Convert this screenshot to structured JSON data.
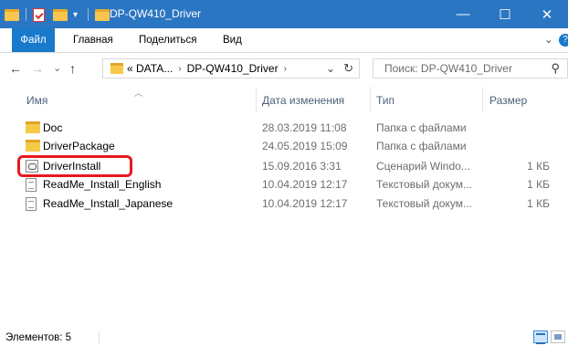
{
  "window": {
    "title": "DP-QW410_Driver",
    "minimize_glyph": "—",
    "maximize_glyph": "☐",
    "close_glyph": "✕"
  },
  "ribbon": {
    "tabs": [
      "Файл",
      "Главная",
      "Поделиться",
      "Вид"
    ],
    "collapse_glyph": "⌄",
    "help_glyph": "?"
  },
  "nav": {
    "back_glyph": "←",
    "forward_glyph": "→",
    "recent_glyph": "⌄",
    "up_glyph": "↑",
    "breadcrumb": [
      "«  DATA...",
      "DP-QW410_Driver"
    ],
    "breadcrumb_sep": "›",
    "refresh_glyph": "↻",
    "dropdown_glyph": "⌄",
    "search_placeholder": "Поиск: DP-QW410_Driver",
    "search_glyph": "⚲"
  },
  "columns": {
    "name": "Имя",
    "date": "Дата изменения",
    "type": "Тип",
    "size": "Размер"
  },
  "files": [
    {
      "name": "Doc",
      "date": "28.03.2019 11:08",
      "type": "Папка с файлами",
      "size": "",
      "icon": "folder"
    },
    {
      "name": "DriverPackage",
      "date": "24.05.2019 15:09",
      "type": "Папка с файлами",
      "size": "",
      "icon": "folder"
    },
    {
      "name": "DriverInstall",
      "date": "15.09.2016 3:31",
      "type": "Сценарий Windo...",
      "size": "1 КБ",
      "icon": "script"
    },
    {
      "name": "ReadMe_Install_English",
      "date": "10.04.2019 12:17",
      "type": "Текстовый докум...",
      "size": "1 КБ",
      "icon": "text-document"
    },
    {
      "name": "ReadMe_Install_Japanese",
      "date": "10.04.2019 12:17",
      "type": "Текстовый докум...",
      "size": "1 КБ",
      "icon": "text-document"
    }
  ],
  "status": {
    "item_count": "Элементов: 5"
  },
  "colors": {
    "titlebar": "#2b76c2",
    "file_tab": "#1979ca",
    "highlight": "#e8181e",
    "folder": "#f7c948"
  }
}
